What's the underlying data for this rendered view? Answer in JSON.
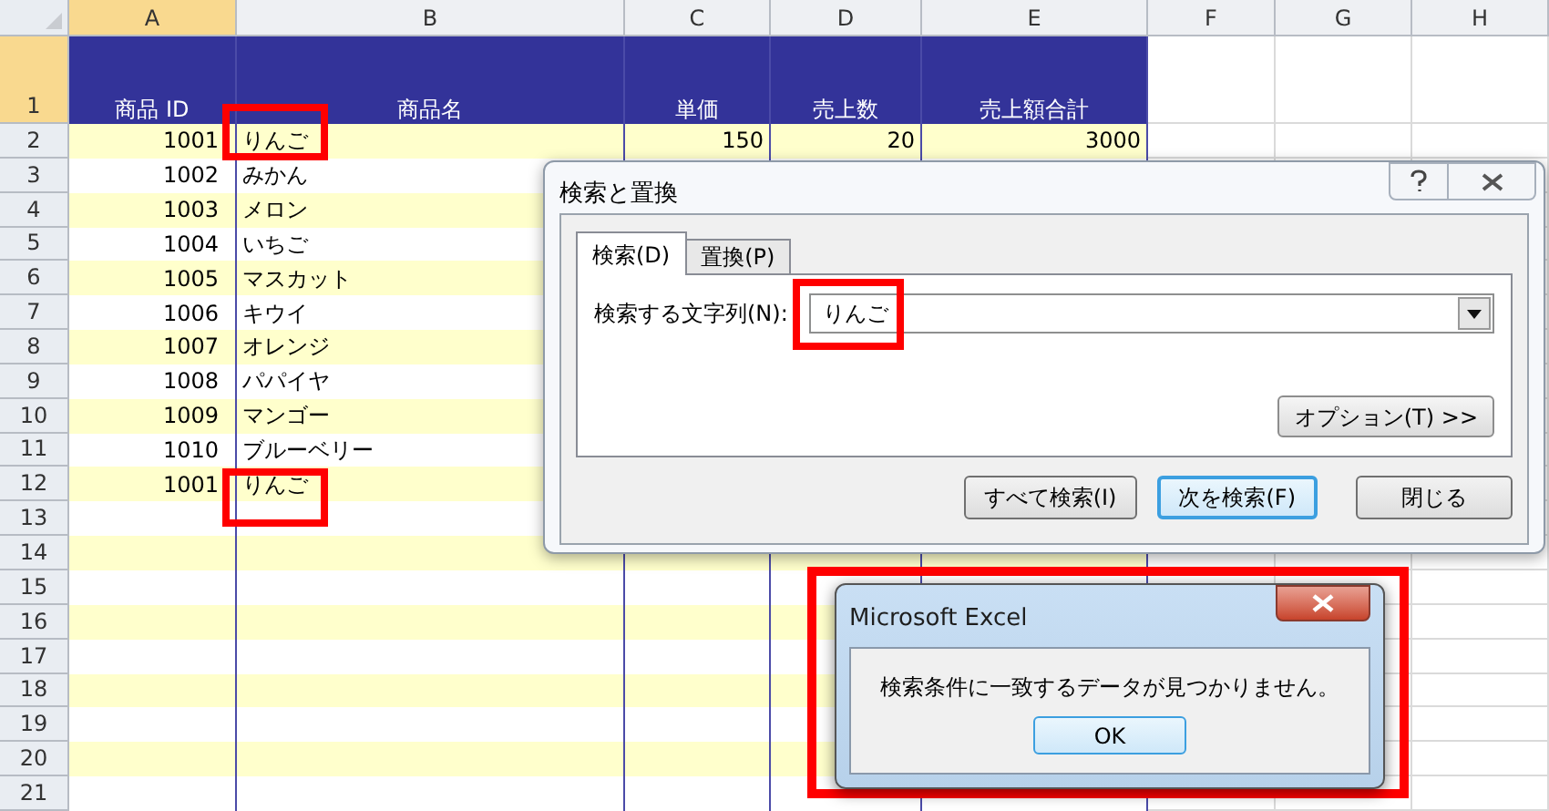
{
  "sheet": {
    "columns": [
      {
        "label": "A",
        "selected": true
      },
      {
        "label": "B",
        "selected": false
      },
      {
        "label": "C",
        "selected": false
      },
      {
        "label": "D",
        "selected": false
      },
      {
        "label": "E",
        "selected": false
      },
      {
        "label": "F",
        "selected": false
      },
      {
        "label": "G",
        "selected": false
      },
      {
        "label": "H",
        "selected": false
      }
    ],
    "rows": [
      {
        "number": "1",
        "kind": "header",
        "selected": true,
        "cells": [
          "商品 ID",
          "商品名",
          "単価",
          "売上数",
          "売上額合計"
        ]
      },
      {
        "number": "2",
        "kind": "data",
        "selected": false,
        "cells": [
          "1001",
          "りんご",
          "150",
          "20",
          "3000"
        ]
      },
      {
        "number": "3",
        "kind": "data",
        "selected": false,
        "cells": [
          "1002",
          "みかん"
        ]
      },
      {
        "number": "4",
        "kind": "data",
        "selected": false,
        "cells": [
          "1003",
          "メロン"
        ]
      },
      {
        "number": "5",
        "kind": "data",
        "selected": false,
        "cells": [
          "1004",
          "いちご"
        ]
      },
      {
        "number": "6",
        "kind": "data",
        "selected": false,
        "cells": [
          "1005",
          "マスカット"
        ]
      },
      {
        "number": "7",
        "kind": "data",
        "selected": false,
        "cells": [
          "1006",
          "キウイ"
        ]
      },
      {
        "number": "8",
        "kind": "data",
        "selected": false,
        "cells": [
          "1007",
          "オレンジ"
        ]
      },
      {
        "number": "9",
        "kind": "data",
        "selected": false,
        "cells": [
          "1008",
          "パパイヤ"
        ]
      },
      {
        "number": "10",
        "kind": "data",
        "selected": false,
        "cells": [
          "1009",
          "マンゴー"
        ]
      },
      {
        "number": "11",
        "kind": "data",
        "selected": false,
        "cells": [
          "1010",
          "ブルーベリー"
        ]
      },
      {
        "number": "12",
        "kind": "data",
        "selected": false,
        "cells": [
          "1001",
          "りんご"
        ]
      },
      {
        "number": "13",
        "kind": "data",
        "selected": false
      },
      {
        "number": "14",
        "kind": "data",
        "selected": false
      },
      {
        "number": "15",
        "kind": "data",
        "selected": false
      },
      {
        "number": "16",
        "kind": "data",
        "selected": false
      },
      {
        "number": "17",
        "kind": "data",
        "selected": false
      },
      {
        "number": "18",
        "kind": "data",
        "selected": false
      },
      {
        "number": "19",
        "kind": "data",
        "selected": false
      },
      {
        "number": "20",
        "kind": "data",
        "selected": false
      },
      {
        "number": "21",
        "kind": "data",
        "selected": false
      }
    ]
  },
  "find_dialog": {
    "title": "検索と置換",
    "tabs": [
      {
        "label": "検索(D)",
        "selected": true
      },
      {
        "label": "置換(P)",
        "selected": false
      }
    ],
    "search_label": "検索する文字列(N):",
    "search_value": "りんご",
    "options_button": "オプション(T) >>",
    "buttons": [
      {
        "label": "すべて検索(I)",
        "default": false
      },
      {
        "label": "次を検索(F)",
        "default": true
      },
      {
        "label": "閉じる",
        "default": false
      }
    ]
  },
  "message_box": {
    "title": "Microsoft Excel",
    "message": "検索条件に一致するデータが見つかりません。",
    "button": "OK"
  }
}
